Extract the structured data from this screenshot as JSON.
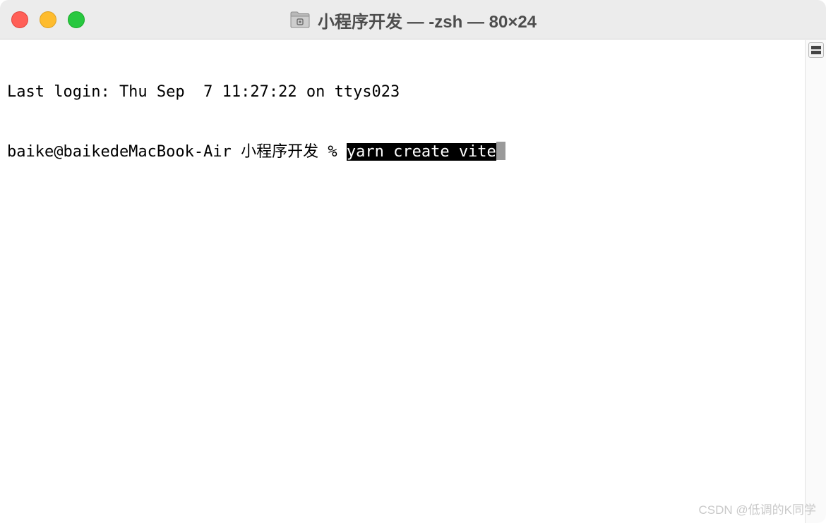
{
  "window": {
    "title": "小程序开发 — -zsh — 80×24",
    "buttons": {
      "close_color": "#ff5f57",
      "minimize_color": "#febc2e",
      "zoom_color": "#28c840"
    }
  },
  "terminal": {
    "line1": "Last login: Thu Sep  7 11:27:22 on ttys023",
    "prompt": "baike@baikedeMacBook-Air 小程序开发 % ",
    "command": "yarn create vite"
  },
  "watermark": "CSDN @低调的K同学"
}
